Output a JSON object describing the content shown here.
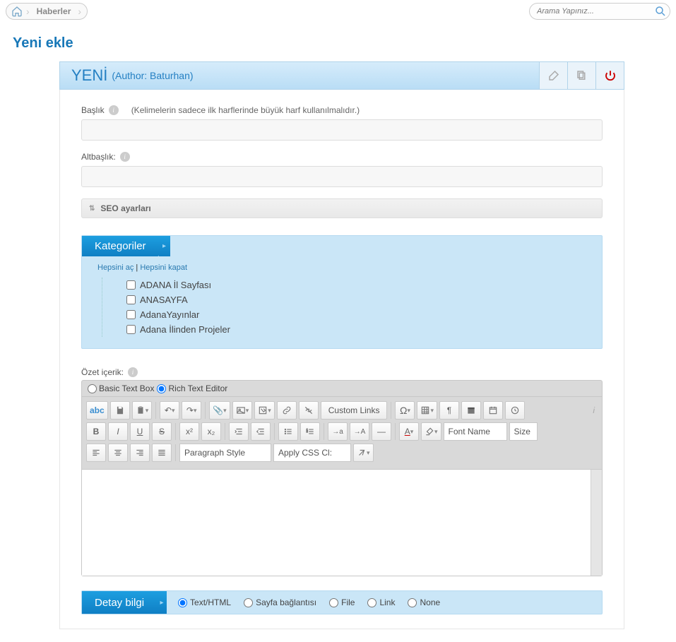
{
  "breadcrumb": {
    "item1": "Haberler"
  },
  "search": {
    "placeholder": "Arama Yapınız..."
  },
  "page": {
    "title": "Yeni ekle"
  },
  "panel": {
    "title": "YENİ",
    "subtitle": "(Author: Baturhan)"
  },
  "form": {
    "title_label": "Başlık",
    "title_hint": "(Kelimelerin sadece ilk harflerinde büyük harf kullanılmalıdır.)",
    "title_value": "",
    "subtitle_label": "Altbaşlık:",
    "subtitle_value": "",
    "seo_label": "SEO ayarları"
  },
  "categories": {
    "header": "Kategoriler",
    "expand_all": "Hepsini aç",
    "collapse_all": "Hepsini kapat",
    "separator": " | ",
    "items": [
      "ADANA İl Sayfası",
      "ANASAYFA",
      "AdanaYayınlar",
      "Adana İlinden Projeler"
    ]
  },
  "summary": {
    "label": "Özet içerik:",
    "mode_basic": "Basic Text Box",
    "mode_rich": "Rich Text Editor"
  },
  "toolbar": {
    "custom_links": "Custom Links",
    "font_name": "Font Name",
    "size": "Size",
    "paragraph_style": "Paragraph Style",
    "apply_css": "Apply CSS Cl:"
  },
  "detail": {
    "header": "Detay bilgi",
    "options": [
      "Text/HTML",
      "Sayfa bağlantısı",
      "File",
      "Link",
      "None"
    ]
  }
}
